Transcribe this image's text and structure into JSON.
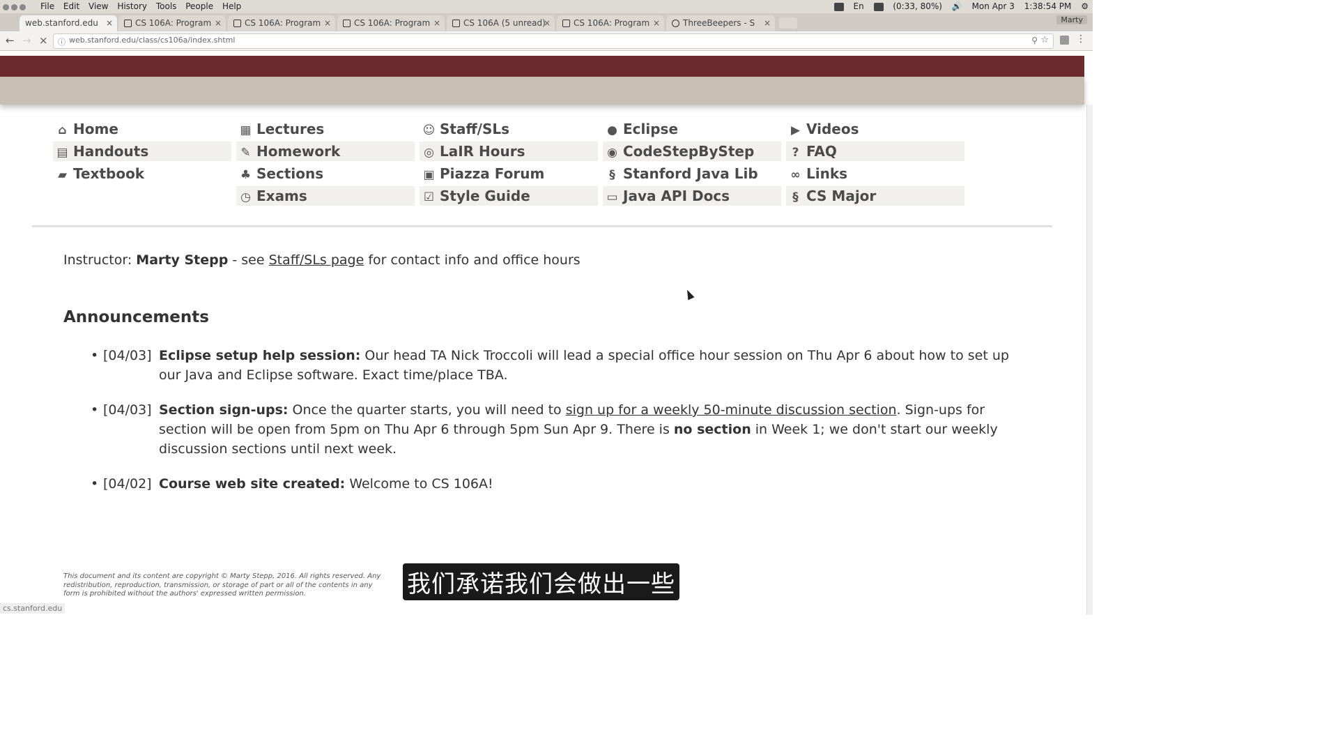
{
  "os": {
    "menus": [
      "File",
      "Edit",
      "View",
      "History",
      "Tools",
      "People",
      "Help"
    ],
    "battery": "(0:33, 80%)",
    "keyboard": "En",
    "date": "Mon Apr 3",
    "time": "1:38:54 PM"
  },
  "browser": {
    "tabs": [
      {
        "title": "web.stanford.edu",
        "active": true
      },
      {
        "title": "CS 106A: Program",
        "active": false
      },
      {
        "title": "CS 106A: Program",
        "active": false
      },
      {
        "title": "CS 106A: Program",
        "active": false
      },
      {
        "title": "CS 106A (5 unread)",
        "active": false
      },
      {
        "title": "CS 106A: Program",
        "active": false
      },
      {
        "title": "ThreeBeepers - S",
        "active": false
      }
    ],
    "profile": "Marty",
    "url": "web.stanford.edu/class/cs106a/index.shtml"
  },
  "nav": {
    "col1": [
      {
        "label": "Home",
        "icon": "home-icon"
      },
      {
        "label": "Handouts",
        "icon": "document-icon"
      },
      {
        "label": "Textbook",
        "icon": "book-icon"
      }
    ],
    "col2": [
      {
        "label": "Lectures",
        "icon": "calendar-icon"
      },
      {
        "label": "Homework",
        "icon": "edit-icon"
      },
      {
        "label": "Sections",
        "icon": "tree-icon"
      },
      {
        "label": "Exams",
        "icon": "clock-icon"
      }
    ],
    "col3": [
      {
        "label": "Staff/SLs",
        "icon": "smiley-icon"
      },
      {
        "label": "LaIR Hours",
        "icon": "lifebuoy-icon"
      },
      {
        "label": "Piazza Forum",
        "icon": "piazza-icon"
      },
      {
        "label": "Style Guide",
        "icon": "checkbox-icon"
      }
    ],
    "col4": [
      {
        "label": "Eclipse",
        "icon": "eclipse-icon"
      },
      {
        "label": "CodeStepByStep",
        "icon": "codestep-icon"
      },
      {
        "label": "Stanford Java Lib",
        "icon": "stanford-s-icon"
      },
      {
        "label": "Java API Docs",
        "icon": "api-icon"
      }
    ],
    "col5": [
      {
        "label": "Videos",
        "icon": "play-icon"
      },
      {
        "label": "FAQ",
        "icon": "question-icon"
      },
      {
        "label": "Links",
        "icon": "link-icon"
      },
      {
        "label": "CS Major",
        "icon": "stanford-s-icon"
      }
    ]
  },
  "instructor": {
    "prefix": "Instructor: ",
    "name": "Marty Stepp",
    "mid": " - see ",
    "link": "Staff/SLs page",
    "suffix": " for contact info and office hours"
  },
  "announcements_title": "Announcements",
  "announcements": [
    {
      "date": "[04/03]",
      "headline": "Eclipse setup help session:",
      "text": " Our head TA Nick Troccoli will lead a special office hour session on Thu Apr 6 about how to set up our Java and Eclipse software. Exact time/place TBA."
    },
    {
      "date": "[04/03]",
      "headline": "Section sign-ups:",
      "text_before": " Once the quarter starts, you will need to ",
      "link": "sign up for a weekly 50-minute discussion section",
      "text_mid": ". Sign-ups for section will be open from 5pm on Thu Apr 6 through 5pm Sun Apr 9. There is ",
      "bold": "no section",
      "text_after": " in Week 1; we don't start our weekly discussion sections until next week."
    },
    {
      "date": "[04/02]",
      "headline": "Course web site created:",
      "text": " Welcome to CS 106A!"
    }
  ],
  "copyright": "This document and its content are copyright © Marty Stepp, 2016. All rights reserved. Any redistribution, reproduction, transmission, or storage of part or all of the contents in any form is prohibited without the authors' expressed written permission.",
  "status": "cs.stanford.edu",
  "subtitle": "我们承诺我们会做出一些"
}
